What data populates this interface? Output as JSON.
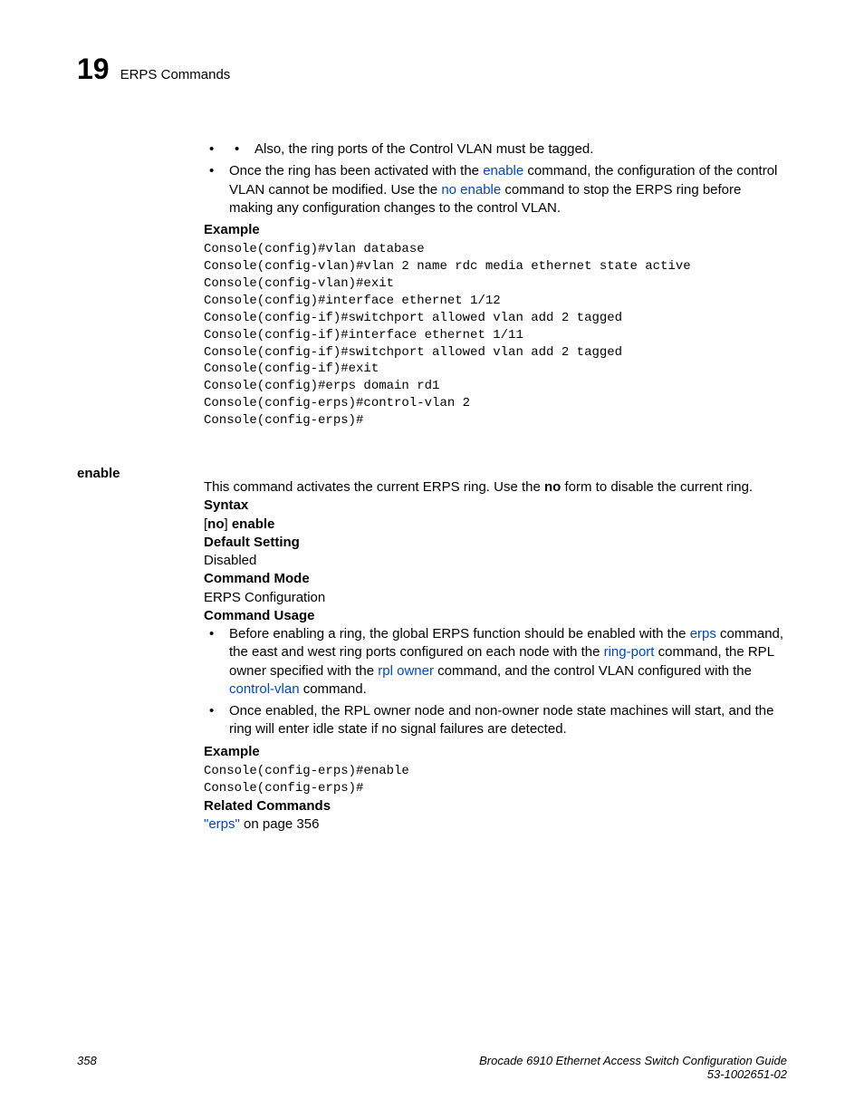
{
  "header": {
    "chapter_num": "19",
    "chapter_title": "ERPS Commands"
  },
  "body": {
    "top_bullets": {
      "inner_bullet": "Also, the ring ports of the Control VLAN must be tagged.",
      "outer_pre": "Once the ring has been activated with the ",
      "outer_link1": "enable",
      "outer_mid1": " command, the configuration of the control VLAN cannot be modified. Use the ",
      "outer_link2": "no enable",
      "outer_mid2": " command to stop the ERPS ring before making any configuration changes to the control VLAN."
    },
    "example1_label": "Example",
    "example1_code": "Console(config)#vlan database\nConsole(config-vlan)#vlan 2 name rdc media ethernet state active\nConsole(config-vlan)#exit\nConsole(config)#interface ethernet 1/12\nConsole(config-if)#switchport allowed vlan add 2 tagged\nConsole(config-if)#interface ethernet 1/11\nConsole(config-if)#switchport allowed vlan add 2 tagged\nConsole(config-if)#exit\nConsole(config)#erps domain rd1\nConsole(config-erps)#control-vlan 2\nConsole(config-erps)#",
    "side_heading": "enable",
    "enable_desc_pre": "This command activates the current ERPS ring. Use the ",
    "enable_desc_bold": "no",
    "enable_desc_post": " form to disable the current ring.",
    "syntax_label": "Syntax",
    "syntax_bracket_open": "[",
    "syntax_no": "no",
    "syntax_bracket_close": "] ",
    "syntax_enable": "enable",
    "default_label": "Default Setting",
    "default_value": "Disabled",
    "mode_label": "Command Mode",
    "mode_value": "ERPS Configuration",
    "usage_label": "Command Usage",
    "usage_bullets": {
      "b1_pre": "Before enabling a ring, the global ERPS function should be enabled with the ",
      "b1_link1": "erps",
      "b1_mid1": " command, the east and west ring ports configured on each node with the ",
      "b1_link2": "ring-port",
      "b1_mid2": " command, the RPL owner specified with the ",
      "b1_link3": "rpl owner",
      "b1_mid3": " command, and the control VLAN configured with the ",
      "b1_link4": "control-vlan",
      "b1_mid4": " command.",
      "b2": "Once enabled, the RPL owner node and non-owner node state machines will start, and the ring will enter idle state if no signal failures are detected."
    },
    "example2_label": "Example",
    "example2_code": "Console(config-erps)#enable\nConsole(config-erps)#",
    "related_label": "Related Commands",
    "related_link": "\"erps\"",
    "related_rest": " on page 356"
  },
  "footer": {
    "page_num": "358",
    "title_line1": "Brocade 6910 Ethernet Access Switch Configuration Guide",
    "title_line2": "53-1002651-02"
  }
}
